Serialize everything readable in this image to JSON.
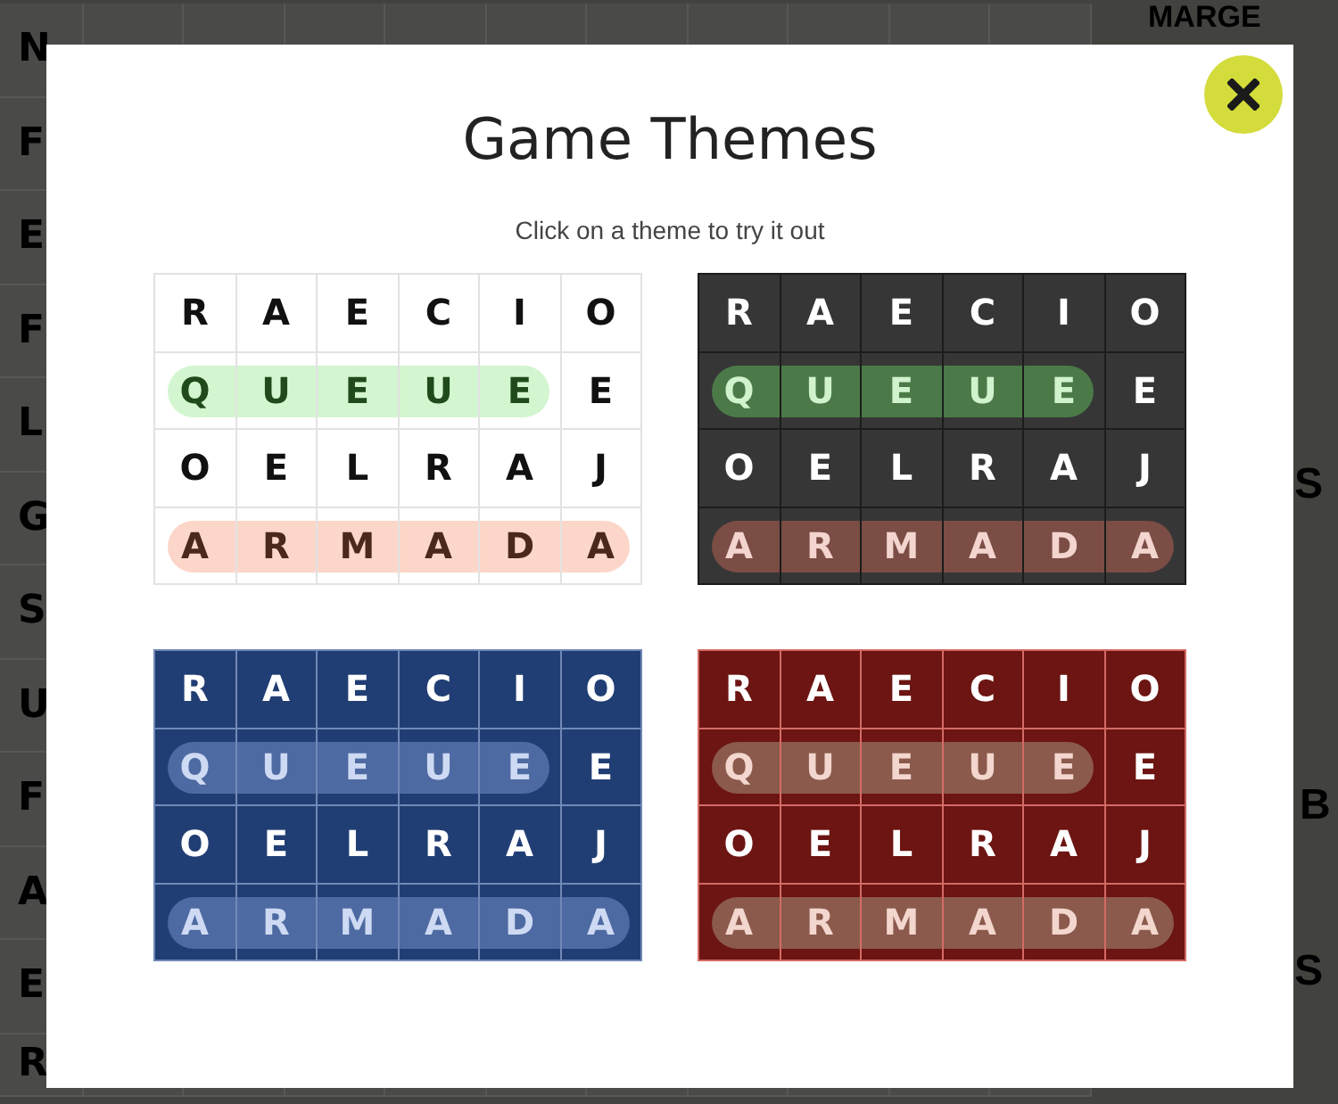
{
  "board": {
    "rows": [
      [
        "N"
      ],
      [
        "F"
      ],
      [
        "E"
      ],
      [
        "F"
      ],
      [
        "L"
      ],
      [
        "G"
      ],
      [
        "S"
      ],
      [
        "U"
      ],
      [
        "F"
      ],
      [
        "A"
      ],
      [
        "E"
      ],
      [
        "R"
      ]
    ]
  },
  "side_panel": {
    "label": "MARGE",
    "texts": [
      "S",
      "B",
      "S"
    ]
  },
  "dialog": {
    "title": "Game Themes",
    "subtitle": "Click on a theme to try it out",
    "themes": [
      {
        "kind": "light",
        "rows": [
          {
            "cells": [
              {
                "letter": "R",
                "found": false
              },
              {
                "letter": "A",
                "found": false
              },
              {
                "letter": "E",
                "found": false
              },
              {
                "letter": "C",
                "found": false
              },
              {
                "letter": "I",
                "found": false
              },
              {
                "letter": "O",
                "found": false
              }
            ]
          },
          {
            "color": "#d3f6d0",
            "cells": [
              {
                "letter": "Q",
                "found": true
              },
              {
                "letter": "U",
                "found": true
              },
              {
                "letter": "E",
                "found": true
              },
              {
                "letter": "U",
                "found": true
              },
              {
                "letter": "E",
                "found": true
              },
              {
                "letter": "E",
                "found": false
              }
            ]
          },
          {
            "cells": [
              {
                "letter": "O",
                "found": false
              },
              {
                "letter": "E",
                "found": false
              },
              {
                "letter": "L",
                "found": false
              },
              {
                "letter": "R",
                "found": false
              },
              {
                "letter": "A",
                "found": false
              },
              {
                "letter": "J",
                "found": false
              }
            ]
          },
          {
            "color": "#fcd6c9",
            "cells": [
              {
                "letter": "A",
                "found": true
              },
              {
                "letter": "R",
                "found": true
              },
              {
                "letter": "M",
                "found": true
              },
              {
                "letter": "A",
                "found": true
              },
              {
                "letter": "D",
                "found": true
              },
              {
                "letter": "A",
                "found": true
              }
            ]
          }
        ]
      },
      {
        "kind": "dark",
        "rows": [
          {
            "cells": [
              {
                "letter": "R",
                "found": false
              },
              {
                "letter": "A",
                "found": false
              },
              {
                "letter": "E",
                "found": false
              },
              {
                "letter": "C",
                "found": false
              },
              {
                "letter": "I",
                "found": false
              },
              {
                "letter": "O",
                "found": false
              }
            ]
          },
          {
            "color": "#4b7a48",
            "cells": [
              {
                "letter": "Q",
                "found": true
              },
              {
                "letter": "U",
                "found": true
              },
              {
                "letter": "E",
                "found": true
              },
              {
                "letter": "U",
                "found": true
              },
              {
                "letter": "E",
                "found": true
              },
              {
                "letter": "E",
                "found": false
              }
            ]
          },
          {
            "cells": [
              {
                "letter": "O",
                "found": false
              },
              {
                "letter": "E",
                "found": false
              },
              {
                "letter": "L",
                "found": false
              },
              {
                "letter": "R",
                "found": false
              },
              {
                "letter": "A",
                "found": false
              },
              {
                "letter": "J",
                "found": false
              }
            ]
          },
          {
            "color": "#7b4d45",
            "cells": [
              {
                "letter": "A",
                "found": true
              },
              {
                "letter": "R",
                "found": true
              },
              {
                "letter": "M",
                "found": true
              },
              {
                "letter": "A",
                "found": true
              },
              {
                "letter": "D",
                "found": true
              },
              {
                "letter": "A",
                "found": true
              }
            ]
          }
        ]
      },
      {
        "kind": "blue",
        "rows": [
          {
            "cells": [
              {
                "letter": "R",
                "found": false
              },
              {
                "letter": "A",
                "found": false
              },
              {
                "letter": "E",
                "found": false
              },
              {
                "letter": "C",
                "found": false
              },
              {
                "letter": "I",
                "found": false
              },
              {
                "letter": "O",
                "found": false
              }
            ]
          },
          {
            "color": "#4e6aa2",
            "cells": [
              {
                "letter": "Q",
                "found": true
              },
              {
                "letter": "U",
                "found": true
              },
              {
                "letter": "E",
                "found": true
              },
              {
                "letter": "U",
                "found": true
              },
              {
                "letter": "E",
                "found": true
              },
              {
                "letter": "E",
                "found": false
              }
            ]
          },
          {
            "cells": [
              {
                "letter": "O",
                "found": false
              },
              {
                "letter": "E",
                "found": false
              },
              {
                "letter": "L",
                "found": false
              },
              {
                "letter": "R",
                "found": false
              },
              {
                "letter": "A",
                "found": false
              },
              {
                "letter": "J",
                "found": false
              }
            ]
          },
          {
            "color": "#4e6aa2",
            "cells": [
              {
                "letter": "A",
                "found": true
              },
              {
                "letter": "R",
                "found": true
              },
              {
                "letter": "M",
                "found": true
              },
              {
                "letter": "A",
                "found": true
              },
              {
                "letter": "D",
                "found": true
              },
              {
                "letter": "A",
                "found": true
              }
            ]
          }
        ]
      },
      {
        "kind": "red",
        "rows": [
          {
            "cells": [
              {
                "letter": "R",
                "found": false
              },
              {
                "letter": "A",
                "found": false
              },
              {
                "letter": "E",
                "found": false
              },
              {
                "letter": "C",
                "found": false
              },
              {
                "letter": "I",
                "found": false
              },
              {
                "letter": "O",
                "found": false
              }
            ]
          },
          {
            "color": "#8b5a4c",
            "cells": [
              {
                "letter": "Q",
                "found": true
              },
              {
                "letter": "U",
                "found": true
              },
              {
                "letter": "E",
                "found": true
              },
              {
                "letter": "U",
                "found": true
              },
              {
                "letter": "E",
                "found": true
              },
              {
                "letter": "E",
                "found": false
              }
            ]
          },
          {
            "cells": [
              {
                "letter": "O",
                "found": false
              },
              {
                "letter": "E",
                "found": false
              },
              {
                "letter": "L",
                "found": false
              },
              {
                "letter": "R",
                "found": false
              },
              {
                "letter": "A",
                "found": false
              },
              {
                "letter": "J",
                "found": false
              }
            ]
          },
          {
            "color": "#8b5a4c",
            "cells": [
              {
                "letter": "A",
                "found": true
              },
              {
                "letter": "R",
                "found": true
              },
              {
                "letter": "M",
                "found": true
              },
              {
                "letter": "A",
                "found": true
              },
              {
                "letter": "D",
                "found": true
              },
              {
                "letter": "A",
                "found": true
              }
            ]
          }
        ]
      }
    ]
  }
}
